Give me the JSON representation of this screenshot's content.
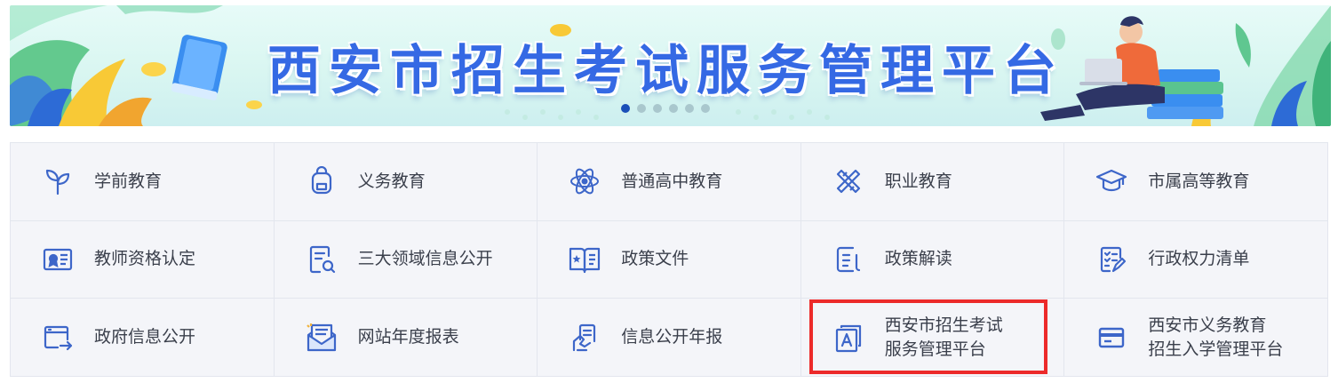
{
  "banner": {
    "title": "西安市招生考试服务管理平台",
    "carousel": {
      "slide_count": 6,
      "active_index": 0
    }
  },
  "colors": {
    "accent_blue": "#3569e4",
    "icon_blue": "#3d66c9",
    "highlight_red": "#ec2a2a",
    "grid_bg": "#f4f5f9"
  },
  "grid": {
    "items": [
      {
        "label": "学前教育",
        "icon": "sprout-icon"
      },
      {
        "label": "义务教育",
        "icon": "backpack-icon"
      },
      {
        "label": "普通高中教育",
        "icon": "atom-icon"
      },
      {
        "label": "职业教育",
        "icon": "tools-cross-icon"
      },
      {
        "label": "市属高等教育",
        "icon": "graduation-cap-icon"
      },
      {
        "label": "教师资格认定",
        "icon": "certificate-icon"
      },
      {
        "label": "三大领域信息公开",
        "icon": "document-search-icon"
      },
      {
        "label": "政策文件",
        "icon": "open-book-star-icon"
      },
      {
        "label": "政策解读",
        "icon": "document-read-icon"
      },
      {
        "label": "行政权力清单",
        "icon": "checklist-icon"
      },
      {
        "label": "政府信息公开",
        "icon": "browser-window-arrow-icon"
      },
      {
        "label": "网站年度报表",
        "icon": "envelope-report-icon"
      },
      {
        "label": "信息公开年报",
        "icon": "hand-document-icon"
      },
      {
        "label_line1": "西安市招生考试",
        "label_line2": "服务管理平台",
        "icon": "exam-paper-a-icon"
      },
      {
        "label_line1": "西安市义务教育",
        "label_line2": "招生入学管理平台",
        "icon": "card-window-icon"
      }
    ]
  }
}
